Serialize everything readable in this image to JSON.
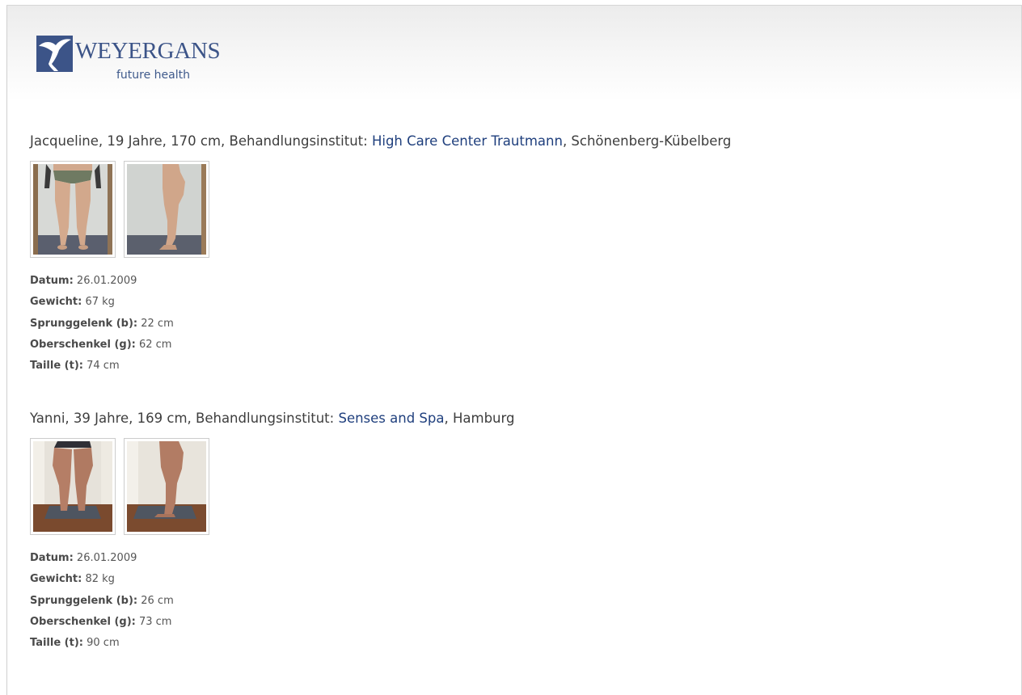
{
  "logo": {
    "name": "WEYERGANS",
    "tagline": "future health",
    "icon": "bird-mark-icon",
    "color": "#3c5488"
  },
  "persons": [
    {
      "intro": "Jacqueline, 19 Jahre, 170 cm, Behandlungsinstitut:",
      "institute_link": "High Care Center Trautmann",
      "location": ", Schönenberg-Kübelberg",
      "photos": [
        "front-view-photo",
        "side-view-photo"
      ],
      "stats": {
        "datum_label": "Datum:",
        "datum_value": "26.01.2009",
        "gewicht_label": "Gewicht:",
        "gewicht_value": "67 kg",
        "sprunggelenk_label": "Sprunggelenk (b):",
        "sprunggelenk_value": "22 cm",
        "oberschenkel_label": "Oberschenkel (g):",
        "oberschenkel_value": "62 cm",
        "taille_label": "Taille (t):",
        "taille_value": "74 cm"
      }
    },
    {
      "intro": "Yanni, 39 Jahre, 169 cm, Behandlungsinstitut:",
      "institute_link": "Senses and Spa",
      "location": ", Hamburg",
      "photos": [
        "front-view-photo",
        "side-view-photo"
      ],
      "stats": {
        "datum_label": "Datum:",
        "datum_value": "26.01.2009",
        "gewicht_label": "Gewicht:",
        "gewicht_value": "82 kg",
        "sprunggelenk_label": "Sprunggelenk (b):",
        "sprunggelenk_value": "26 cm",
        "oberschenkel_label": "Oberschenkel (g):",
        "oberschenkel_value": "73 cm",
        "taille_label": "Taille (t):",
        "taille_value": "90 cm"
      }
    }
  ],
  "colors": {
    "link": "#1f3f7d",
    "text": "#3e3e3e"
  }
}
